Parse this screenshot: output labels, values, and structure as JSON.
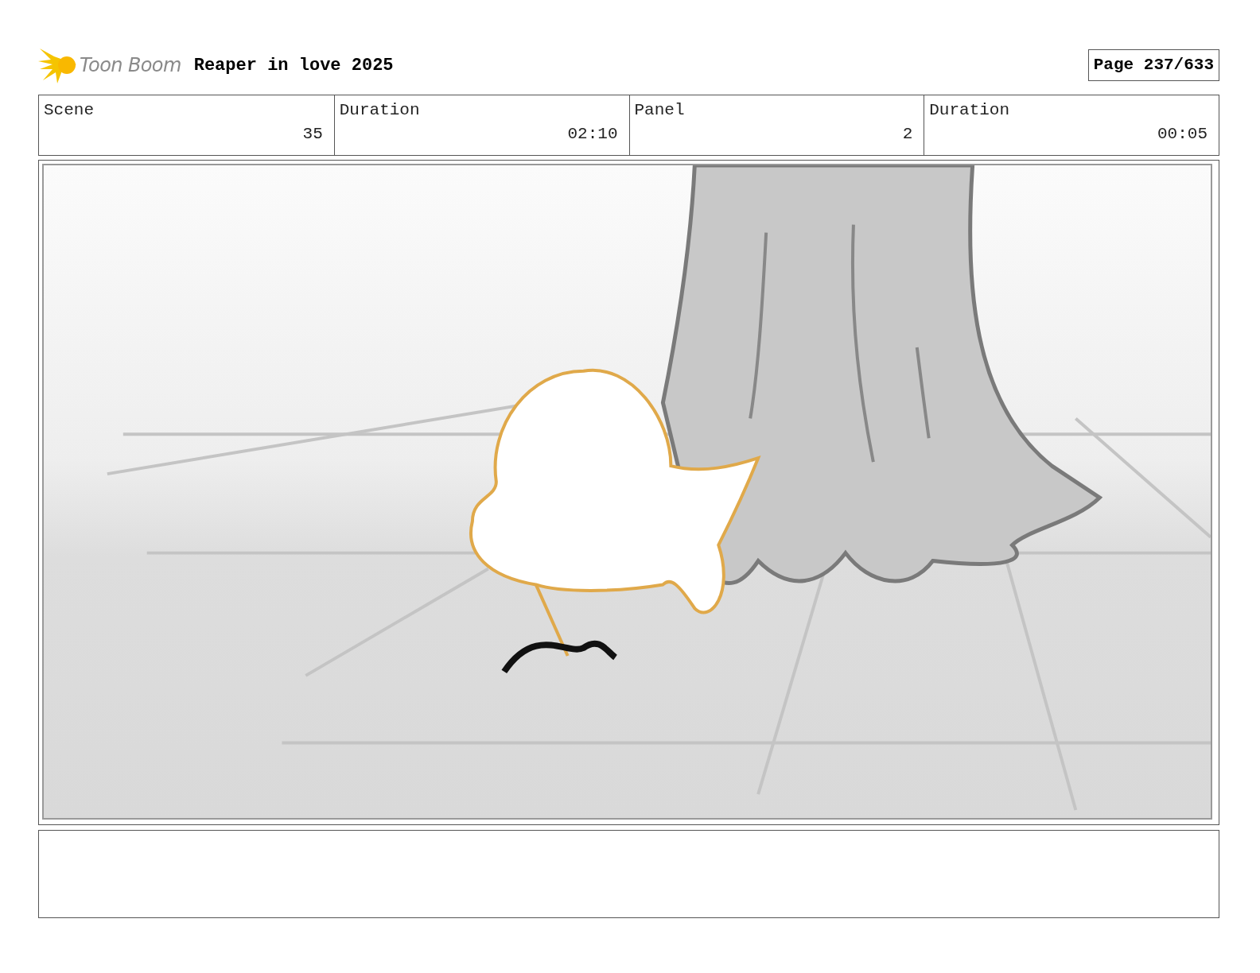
{
  "header": {
    "logo_text": "Toon Boom",
    "project_title": "Reaper in love 2025",
    "page": "Page 237/633"
  },
  "fields": [
    {
      "label": "Scene",
      "value": "35"
    },
    {
      "label": "Duration",
      "value": "02:10"
    },
    {
      "label": "Panel",
      "value": "2"
    },
    {
      "label": "Duration",
      "value": "00:05"
    }
  ],
  "panel": {
    "kind": "sketch"
  }
}
